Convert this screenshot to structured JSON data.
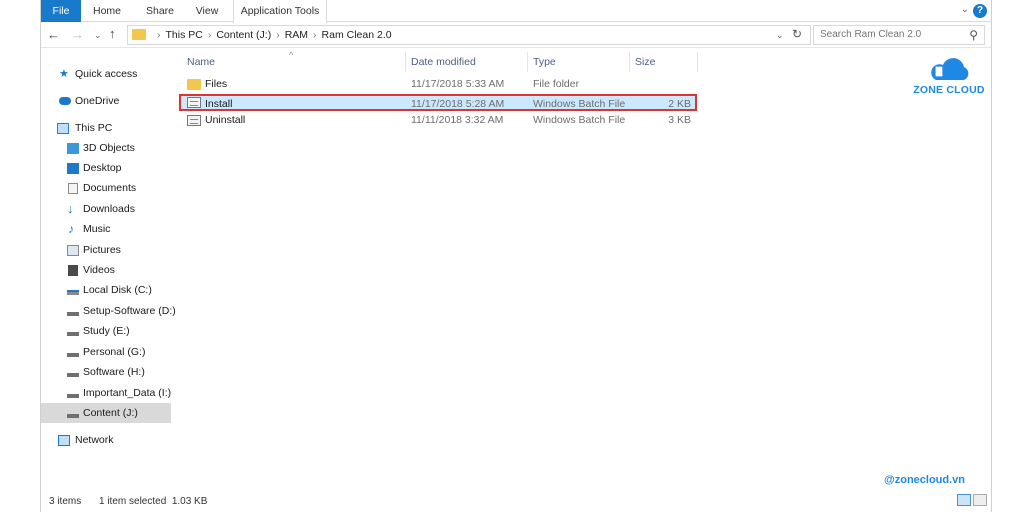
{
  "ribbon": {
    "tabs": [
      "File",
      "Home",
      "Share",
      "View",
      "Application Tools"
    ],
    "expand_glyph": "⌄",
    "help_glyph": "?"
  },
  "nav": {
    "back_glyph": "←",
    "forward_glyph": "→",
    "recent_glyph": "⌄",
    "up_glyph": "↑",
    "dropdown_glyph": "⌄",
    "refresh_glyph": "↻"
  },
  "address": {
    "crumbs": [
      "This PC",
      "Content (J:)",
      "RAM",
      "Ram Clean 2.0"
    ],
    "separator": "›"
  },
  "search": {
    "placeholder": "Search Ram Clean 2.0",
    "icon": "search-icon"
  },
  "sidebar": {
    "items": [
      {
        "label": "Quick access",
        "icon": "star-icon"
      },
      {
        "label": "OneDrive",
        "icon": "cloud-icon"
      },
      {
        "label": "This PC",
        "icon": "computer-icon"
      },
      {
        "label": "3D Objects",
        "icon": "cube-icon"
      },
      {
        "label": "Desktop",
        "icon": "desktop-icon"
      },
      {
        "label": "Documents",
        "icon": "documents-icon"
      },
      {
        "label": "Downloads",
        "icon": "download-icon"
      },
      {
        "label": "Music",
        "icon": "music-icon"
      },
      {
        "label": "Pictures",
        "icon": "pictures-icon"
      },
      {
        "label": "Videos",
        "icon": "videos-icon"
      },
      {
        "label": "Local Disk (C:)",
        "icon": "drive-icon"
      },
      {
        "label": "Setup-Software (D:)",
        "icon": "drive-icon"
      },
      {
        "label": "Study (E:)",
        "icon": "drive-icon"
      },
      {
        "label": "Personal (G:)",
        "icon": "drive-icon"
      },
      {
        "label": "Software (H:)",
        "icon": "drive-icon"
      },
      {
        "label": "Important_Data (I:)",
        "icon": "drive-icon"
      },
      {
        "label": "Content (J:)",
        "icon": "drive-icon"
      },
      {
        "label": "Network",
        "icon": "network-icon"
      }
    ]
  },
  "columns": {
    "name": "Name",
    "date": "Date modified",
    "type": "Type",
    "size": "Size",
    "sort_glyph": "^"
  },
  "files": [
    {
      "name": "Files",
      "date": "11/17/2018 5:33 AM",
      "type": "File folder",
      "size": "",
      "icon": "folder-icon"
    },
    {
      "name": "Install",
      "date": "11/17/2018 5:28 AM",
      "type": "Windows Batch File",
      "size": "2 KB",
      "icon": "batch-file-icon"
    },
    {
      "name": "Uninstall",
      "date": "11/11/2018 3:32 AM",
      "type": "Windows Batch File",
      "size": "3 KB",
      "icon": "batch-file-icon"
    }
  ],
  "status": {
    "count": "3 items",
    "selection": "1 item selected  1.03 KB"
  },
  "watermark": {
    "logo_text": "ZONE CLOUD",
    "site": "@zonecloud.vn"
  },
  "colors": {
    "accent": "#1979ca",
    "selection_bg": "#cce8ff",
    "highlight_border": "#dd3333",
    "watermark": "#1e88e5"
  }
}
